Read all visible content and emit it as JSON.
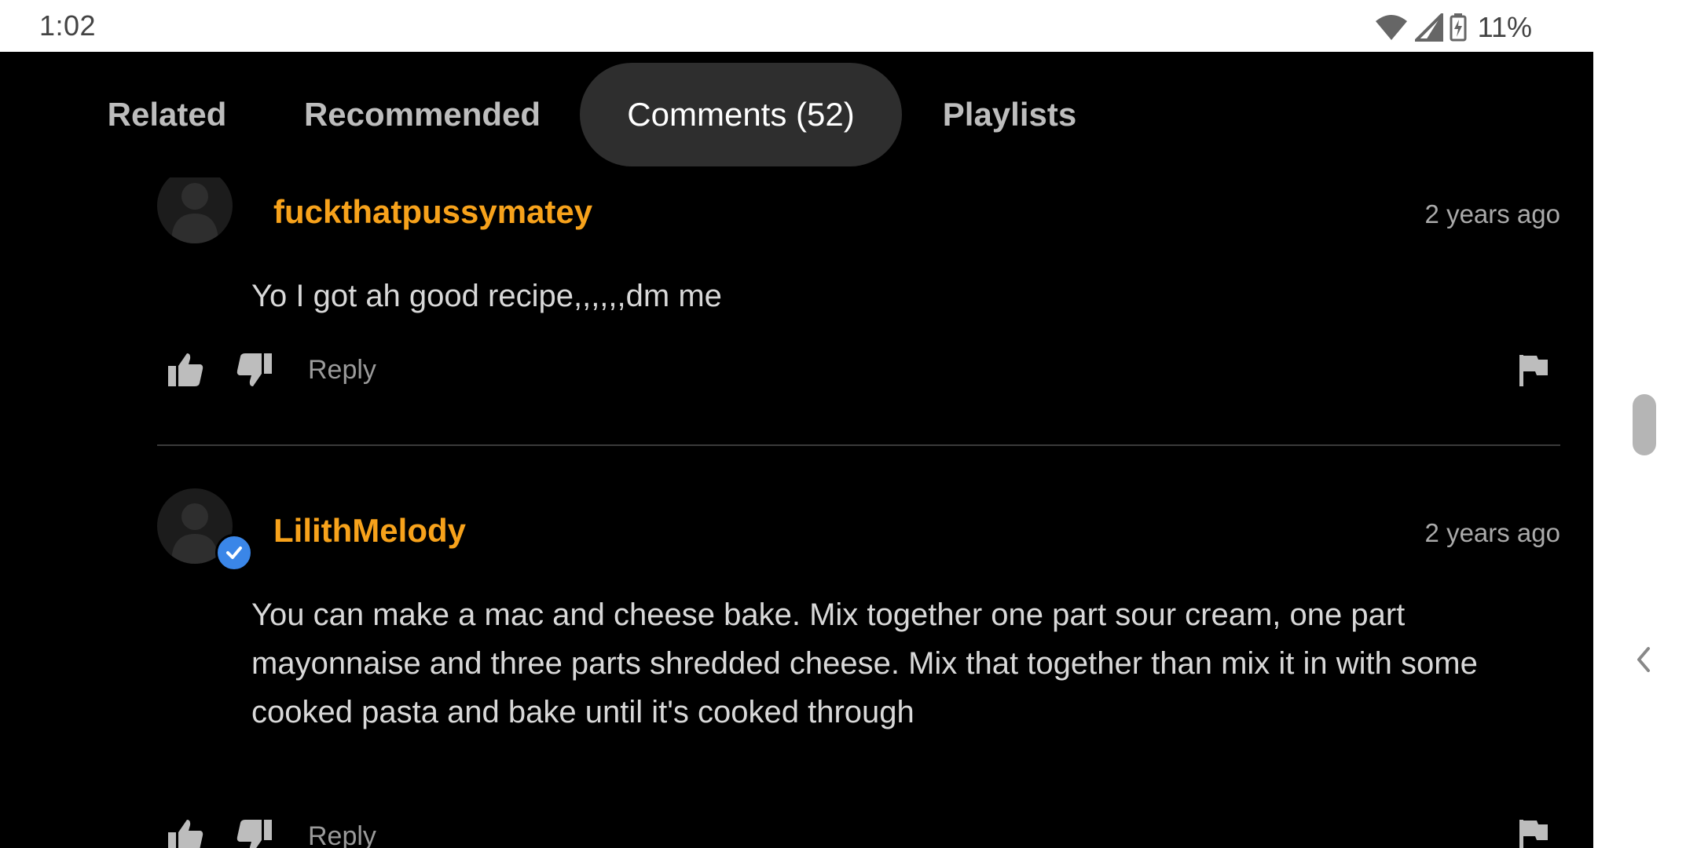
{
  "status_bar": {
    "time": "1:02",
    "battery": "11%",
    "icons": [
      "wifi-icon",
      "signal-icon",
      "battery-charging-icon"
    ]
  },
  "tabs": [
    {
      "label": "Related",
      "active": false
    },
    {
      "label": "Recommended",
      "active": false
    },
    {
      "label": "Comments (52)",
      "active": true
    },
    {
      "label": "Playlists",
      "active": false
    }
  ],
  "comments": [
    {
      "username": "fuckthatpussymatey",
      "timestamp": "2 years ago",
      "text": "Yo I got ah good recipe,,,,,,dm me",
      "verified": false,
      "reply_label": "Reply"
    },
    {
      "username": "LilithMelody",
      "timestamp": "2 years ago",
      "text": "You can make a mac and cheese bake. Mix together one part sour cream, one part mayonnaise and three parts shredded cheese. Mix that together than mix it in with some cooked pasta and bake until it's cooked through",
      "verified": true,
      "reply_label": "Reply"
    }
  ],
  "colors": {
    "background": "#000000",
    "username": "#f7a21b",
    "active_tab": "#2e2e2e",
    "verified_badge": "#3a86e8"
  }
}
